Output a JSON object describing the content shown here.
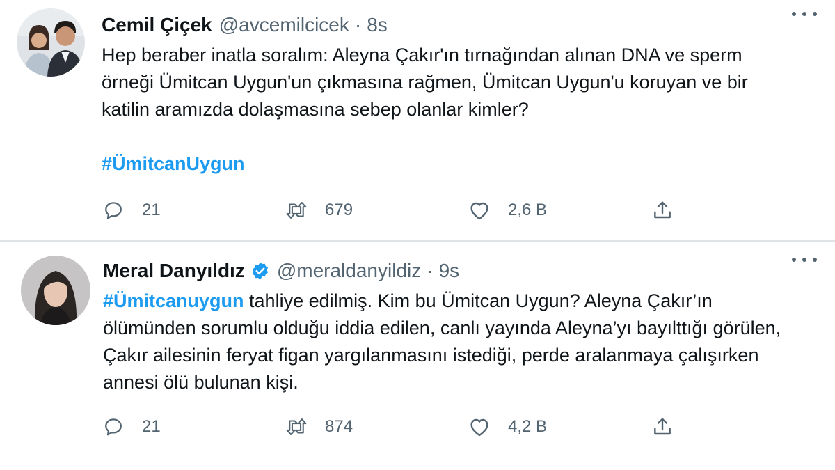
{
  "tweets": [
    {
      "author_name": "Cemil Çiçek",
      "handle": "@avcemilcicek",
      "separator": "·",
      "time": "8s",
      "text": "Hep beraber inatla soralım: Aleyna Çakır'ın tırnağından alınan DNA ve sperm örneği Ümitcan Uygun'un çıkmasına rağmen, Ümitcan Uygun'u koruyan ve bir katilin aramızda dolaşmasına sebep olanlar kimler?",
      "hashtag": "#ÜmitcanUygun",
      "replies": "21",
      "retweets": "679",
      "likes": "2,6 B",
      "verified": false
    },
    {
      "author_name": "Meral Danyıldız",
      "handle": "@meraldanyildiz",
      "separator": "·",
      "time": "9s",
      "hashtag": "#Ümitcanuygun",
      "text": " tahliye edilmiş. Kim bu Ümitcan Uygun? Aleyna Çakır’ın ölümünden sorumlu olduğu iddia edilen, canlı yayında Aleyna’yı bayılttığı görülen, Çakır ailesinin feryat figan yargılanmasını istediği, perde aralanmaya çalışırken annesi ölü bulunan kişi.",
      "replies": "21",
      "retweets": "874",
      "likes": "4,2 B",
      "verified": true
    }
  ],
  "icons": {
    "reply": "speech-bubble-icon",
    "retweet": "retweet-icon",
    "like": "heart-icon",
    "share": "share-icon",
    "more": "more-dots-icon",
    "verified": "verified-badge-icon"
  },
  "colors": {
    "hashtag": "#1d9bf0",
    "muted": "#536471",
    "verified": "#1d9bf0"
  }
}
